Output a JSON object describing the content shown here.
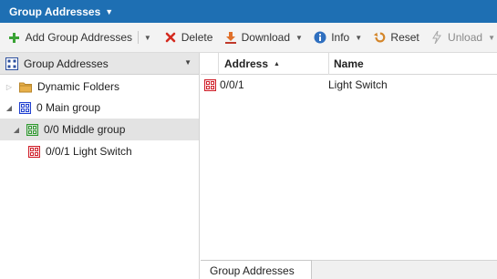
{
  "titlebar": {
    "title": "Group Addresses"
  },
  "toolbar": {
    "add_label": "Add Group Addresses",
    "delete_label": "Delete",
    "download_label": "Download",
    "info_label": "Info",
    "reset_label": "Reset",
    "unload_label": "Unload"
  },
  "left_panel": {
    "header_label": "Group Addresses",
    "tree": [
      {
        "label": "Dynamic Folders",
        "icon": "folder-icon"
      },
      {
        "label": "0 Main group",
        "icon": "main-group-icon"
      },
      {
        "label": "0/0 Middle group",
        "icon": "middle-group-icon"
      },
      {
        "label": "0/0/1 Light Switch",
        "icon": "group-address-icon"
      }
    ]
  },
  "grid": {
    "columns": [
      "Address",
      "Name"
    ],
    "rows": [
      {
        "address": "0/0/1",
        "name": "Light Switch"
      }
    ]
  },
  "bottom_tabs": [
    "Group Addresses"
  ],
  "colors": {
    "titlebar": "#1e6fb3",
    "main_group_icon": "#1f3fd0",
    "middle_group_icon": "#2e9a2e",
    "address_icon": "#d0202a"
  }
}
